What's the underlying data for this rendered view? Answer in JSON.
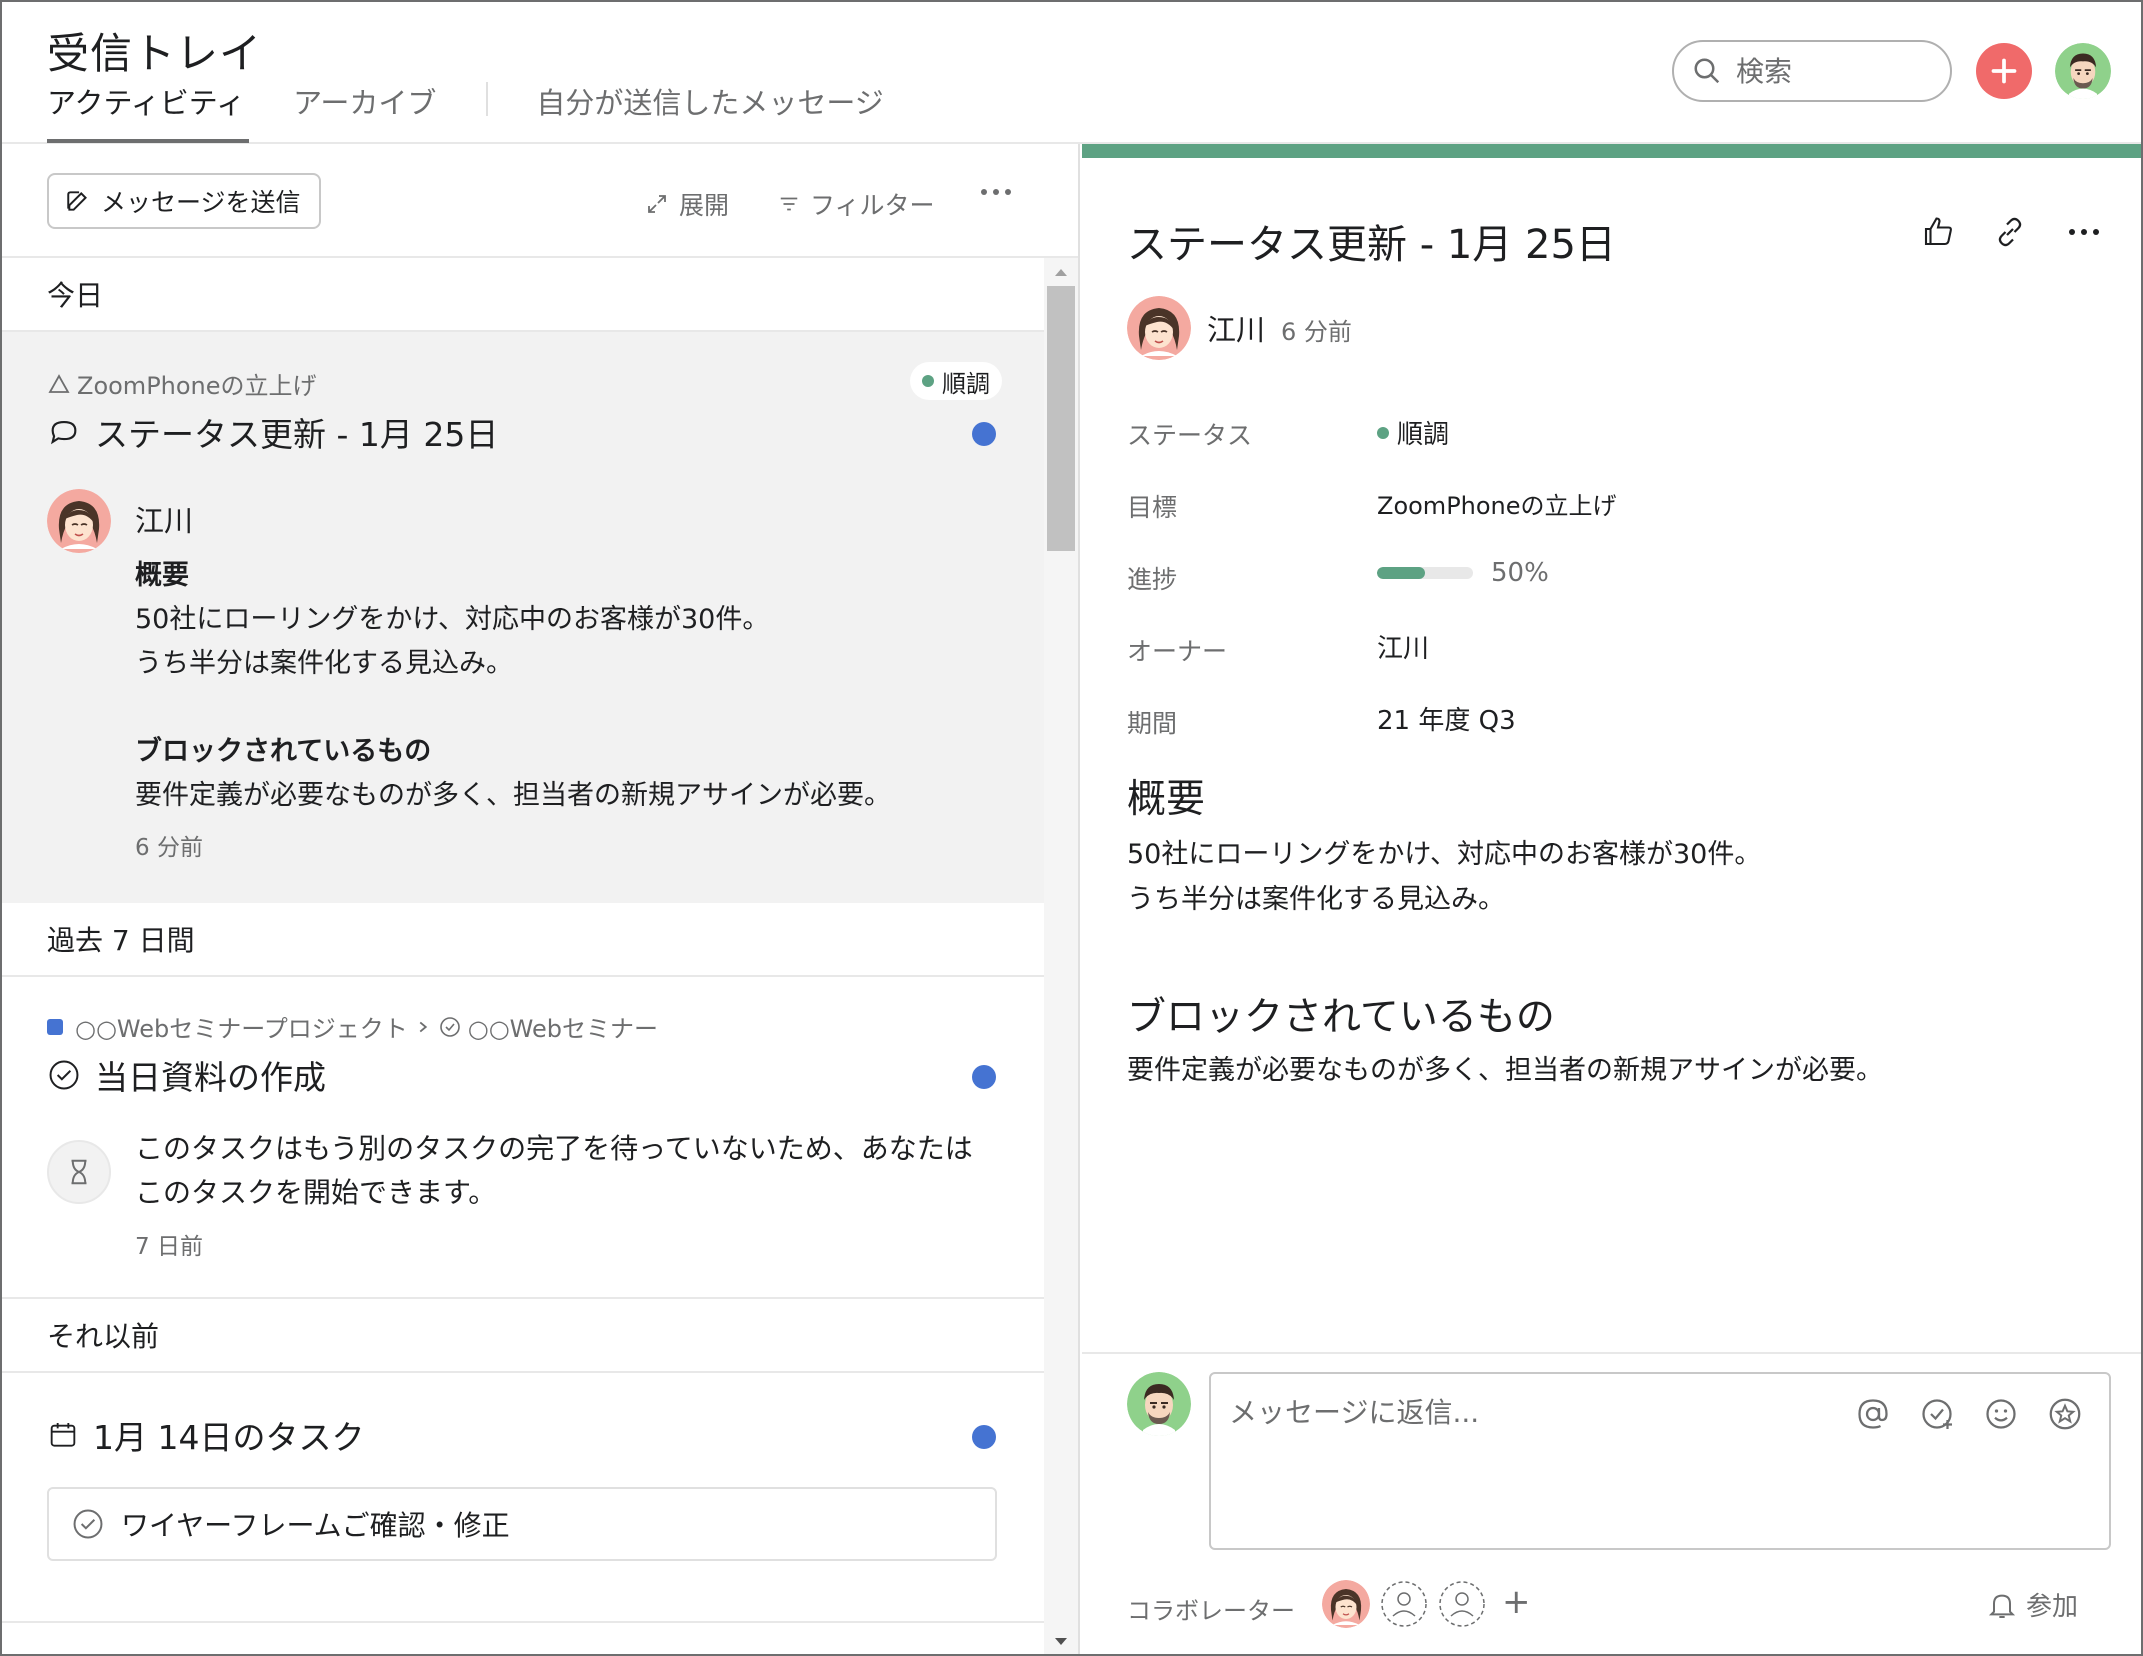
{
  "header": {
    "title": "受信トレイ",
    "tabs": [
      {
        "label": "アクティビティ",
        "active": true
      },
      {
        "label": "アーカイブ",
        "active": false
      },
      {
        "label": "自分が送信したメッセージ",
        "active": false
      }
    ],
    "search_placeholder": "検索"
  },
  "toolbar": {
    "send_label": "メッセージを送信",
    "expand_label": "展開",
    "filter_label": "フィルター"
  },
  "sections": {
    "today": "今日",
    "past7": "過去 7 日間",
    "older": "それ以前"
  },
  "cards": {
    "status_update": {
      "project": "ZoomPhoneの立上げ",
      "status": "順調",
      "title": "ステータス更新 - 1月 25日",
      "author": "江川",
      "summary_heading": "概要",
      "summary_lines": [
        "50社にローリングをかけ、対応中のお客様が30件。",
        "うち半分は案件化する見込み。"
      ],
      "blockers_heading": "ブロックされているもの",
      "blockers_line": "要件定義が必要なものが多く、担当者の新規アサインが必要。",
      "time": "6 分前"
    },
    "task": {
      "project": "○○Webセミナープロジェクト",
      "parent": "○○Webセミナー",
      "title": "当日資料の作成",
      "message_lines": [
        "このタスクはもう別のタスクの完了を待っていないため、あなたは",
        "このタスクを開始できます。"
      ],
      "time": "7 日前"
    },
    "daily": {
      "title": "1月 14日のタスク",
      "subtask": "ワイヤーフレームご確認・修正"
    }
  },
  "detail": {
    "title": "ステータス更新 - 1月 25日",
    "author": "江川",
    "time": "6 分前",
    "fields": {
      "status_label": "ステータス",
      "status_value": "順調",
      "goal_label": "目標",
      "goal_value": "ZoomPhoneの立上げ",
      "progress_label": "進捗",
      "progress_value": "50%",
      "progress_fraction": 0.5,
      "owner_label": "オーナー",
      "owner_value": "江川",
      "period_label": "期間",
      "period_value": "21 年度 Q3"
    },
    "summary_heading": "概要",
    "summary_lines": [
      "50社にローリングをかけ、対応中のお客様が30件。",
      "うち半分は案件化する見込み。"
    ],
    "blockers_heading": "ブロックされているもの",
    "blockers_line": "要件定義が必要なものが多く、担当者の新規アサインが必要。",
    "reply_placeholder": "メッセージに返信...",
    "collaborators_label": "コラボレーター",
    "add_symbol": "+",
    "join_label": "参加"
  },
  "colors": {
    "accent_green": "#5da283",
    "unread_blue": "#4573d2",
    "add_red": "#f06a6a",
    "project_blue": "#4573d2"
  }
}
